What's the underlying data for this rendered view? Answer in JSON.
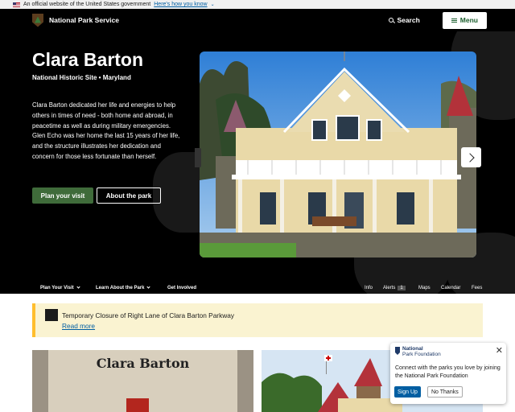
{
  "gov_banner": {
    "text": "An official website of the United States government",
    "link": "Here's how you know"
  },
  "header": {
    "brand": "National Park Service",
    "search_label": "Search",
    "menu_label": "Menu"
  },
  "hero": {
    "title": "Clara Barton",
    "subtitle": "National Historic Site • Maryland",
    "description": "Clara Barton dedicated her life and energies to help others in times of need - both home and abroad, in peacetime as well as during military emergencies. Glen Echo was her home the last 15 years of her life, and the structure illustrates her dedication and concern for those less fortunate than herself.",
    "plan_button": "Plan your visit",
    "about_button": "About the park"
  },
  "subnav": {
    "left": [
      "Plan Your Visit",
      "Learn About the Park",
      "Get Involved"
    ],
    "info": "Info",
    "alerts": "Alerts",
    "alerts_count": "1",
    "maps": "Maps",
    "calendar": "Calendar",
    "fees": "Fees"
  },
  "alert": {
    "title": "Temporary Closure of Right Lane of Clara Barton Parkway",
    "link": "Read more"
  },
  "cards": {
    "book_title": "Clara Barton"
  },
  "popup": {
    "brand_line1": "National",
    "brand_line2": "Park Foundation",
    "message": "Connect with the parks you love by joining the National Park Foundation",
    "signup": "Sign Up",
    "no_thanks": "No Thanks"
  }
}
